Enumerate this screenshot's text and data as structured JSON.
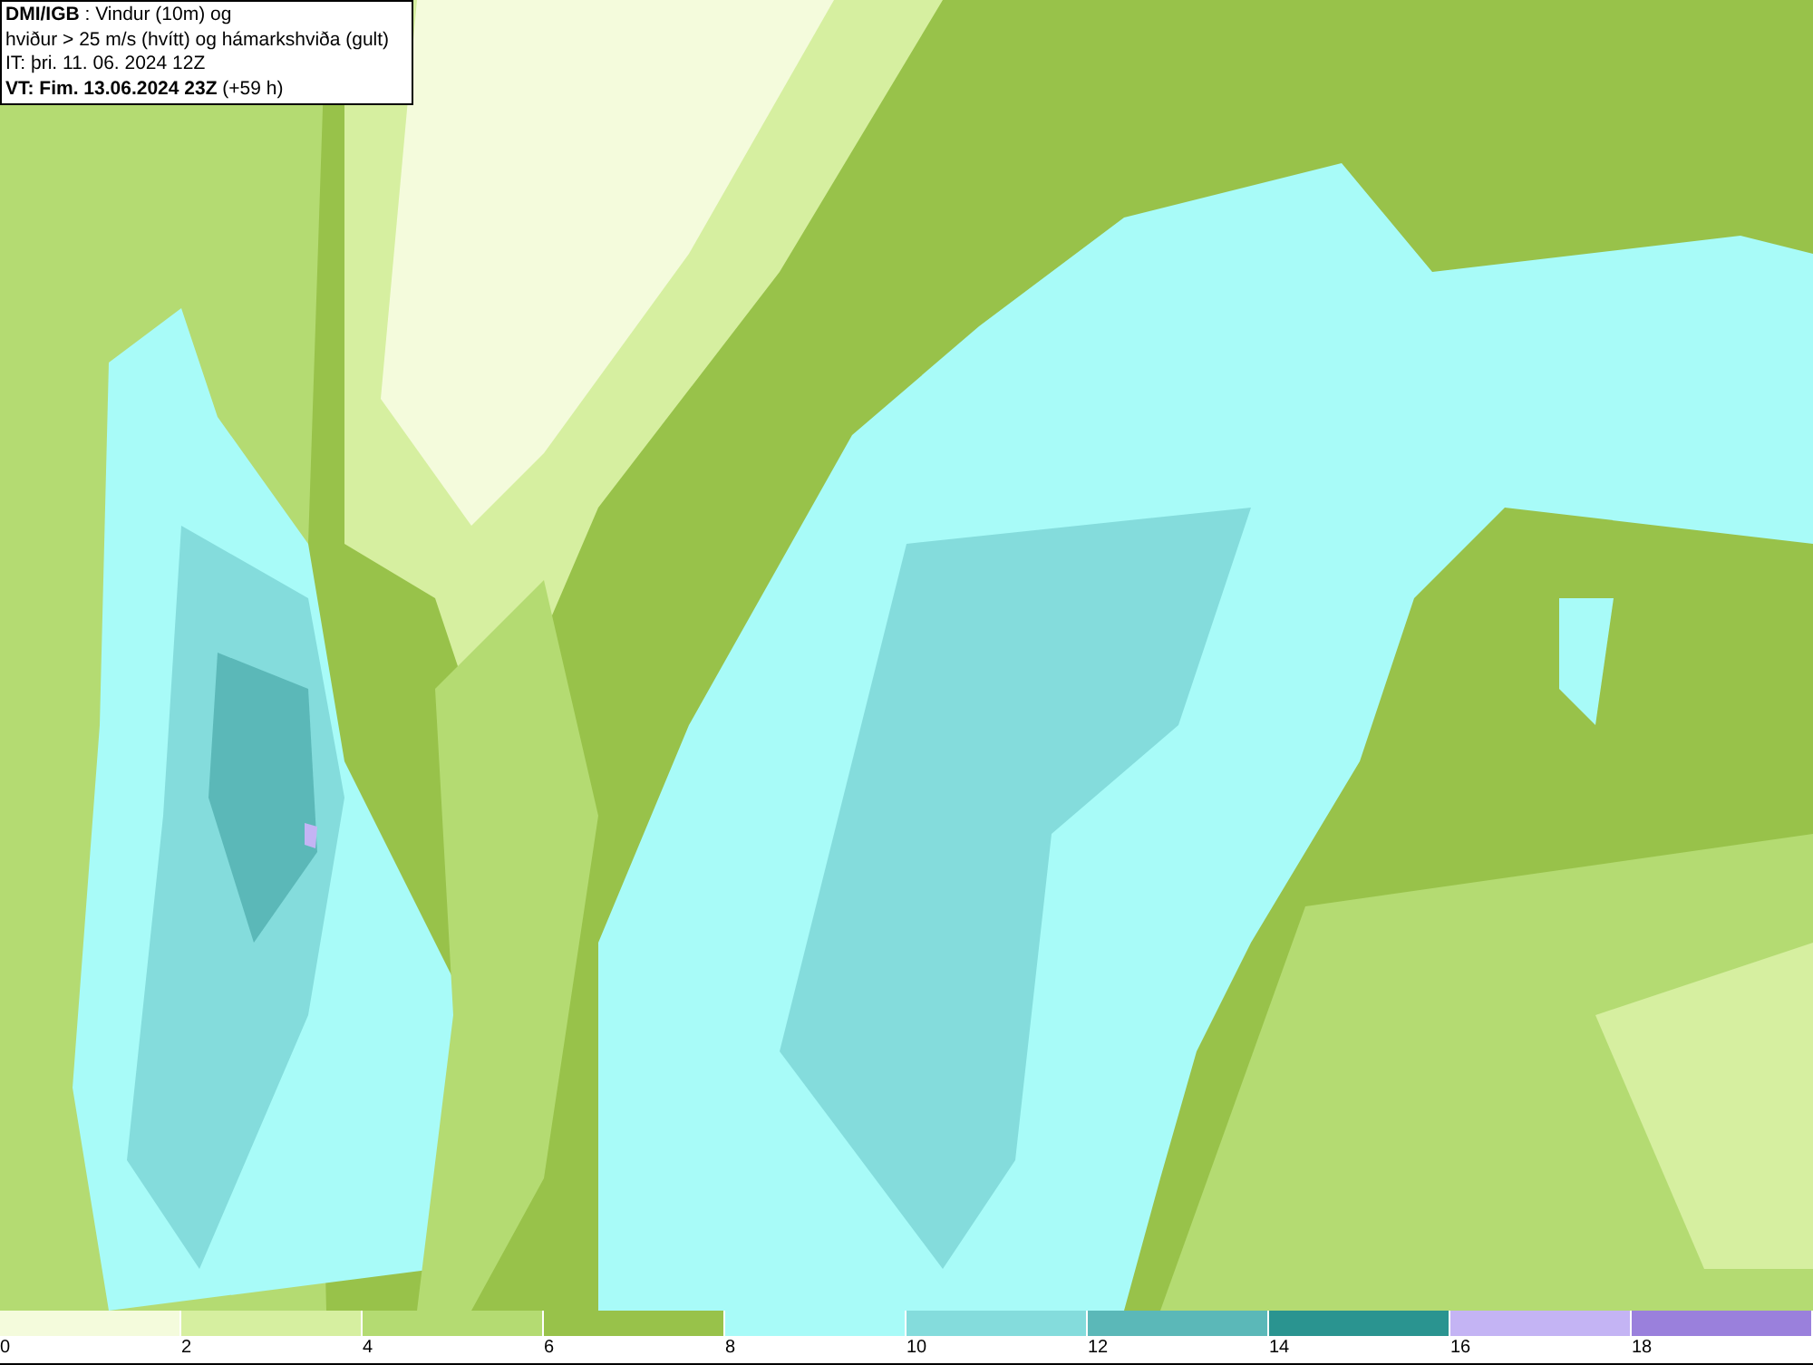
{
  "title_box": {
    "lines": [
      "**DMI/IGB** : Vindur (10m) og",
      "hviður > 25 m/s (hvítt) og hámarkshviða (gult)",
      "IT: þri. 11. 06. 2024 12Z",
      "**VT: Fim. 13.06.2024 23Z** (+59 h)"
    ]
  },
  "legend": [
    {
      "label": "0",
      "color": "#f4fbdc"
    },
    {
      "label": "2",
      "color": "#d6efa0"
    },
    {
      "label": "4",
      "color": "#b4db72"
    },
    {
      "label": "6",
      "color": "#98c24a"
    },
    {
      "label": "8",
      "color": "#a8fbf8"
    },
    {
      "label": "10",
      "color": "#84dcdc"
    },
    {
      "label": "12",
      "color": "#5bb8b8"
    },
    {
      "label": "14",
      "color": "#2a9490"
    },
    {
      "label": "16",
      "color": "#c4b4f4"
    },
    {
      "label": "18",
      "color": "#9a80dc"
    }
  ]
}
